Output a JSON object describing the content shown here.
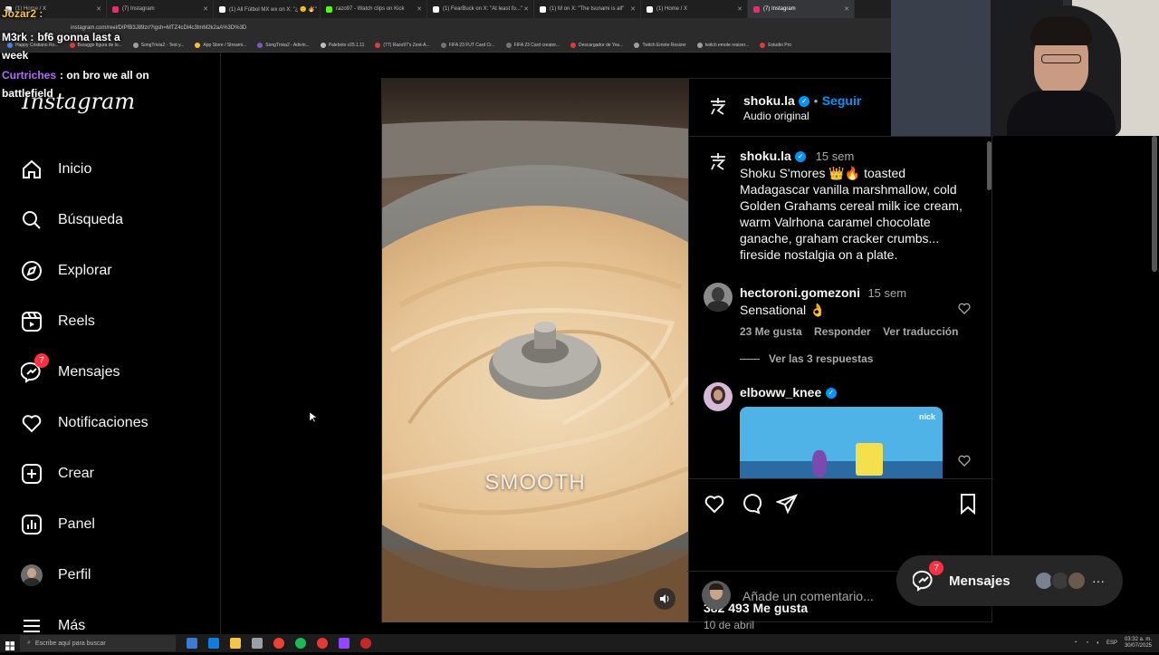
{
  "browser": {
    "tabs": [
      {
        "label": "(1) Home / X",
        "color": "#ffffff",
        "active": false
      },
      {
        "label": "(7) Instagram",
        "color": "#e1306c",
        "active": false
      },
      {
        "label": "(1) All Fútbol MX wx on X: \"¿ 🙂 🔥\"",
        "color": "#ffffff",
        "active": false
      },
      {
        "label": "razo97 - Watch clips on Kick",
        "color": "#53fc18",
        "active": false
      },
      {
        "label": "(1) FearBuck on X: \"At least fo...\"",
        "color": "#ffffff",
        "active": false
      },
      {
        "label": "(1) M on X: \"The tsunami is all\"",
        "color": "#ffffff",
        "active": false
      },
      {
        "label": "(1) Home / X",
        "color": "#ffffff",
        "active": false
      },
      {
        "label": "(7) Instagram",
        "color": "#e1306c",
        "active": true
      }
    ],
    "url": "instagram.com/reel/DIPfB3J89zr/?igsh=MTZ4cDl4c3lmM2k2aA%3D%3D",
    "bookmarks": [
      {
        "label": "Happy Cristiano Ro...",
        "color": "#4285f4"
      },
      {
        "label": "Buraggo figura de lo...",
        "color": "#e53935"
      },
      {
        "label": "SongTrivia2 - Test y...",
        "color": "#9e9e9e"
      },
      {
        "label": "App Store / Streami...",
        "color": "#fbc02d"
      },
      {
        "label": "SongTrivia2 - Adivin...",
        "color": "#7e57c2"
      },
      {
        "label": "Palebots v25.1.11",
        "color": "#bdbdbd"
      },
      {
        "label": "(77) Razo97's Zest-A...",
        "color": "#e53935"
      },
      {
        "label": "FIFA 23 FUT Card Cr...",
        "color": "#757575"
      },
      {
        "label": "FIFA 23 Card creator...",
        "color": "#757575"
      },
      {
        "label": "Descargador de You...",
        "color": "#e53935"
      },
      {
        "label": "Twitch Emote Resizer",
        "color": "#9e9e9e"
      },
      {
        "label": "twitch emote resizer...",
        "color": "#9e9e9e"
      },
      {
        "label": "Estudio Pro",
        "color": "#e53935"
      }
    ]
  },
  "chat": [
    {
      "user": "Jozar2 :",
      "text": "",
      "user_color": "#f5c542"
    },
    {
      "user": "M3rk :",
      "text": "bf6 gonna last a",
      "user_color": "#ffffff"
    },
    {
      "user": "",
      "text": "week",
      "user_color": "#ffffff"
    },
    {
      "user": "Curtriches",
      "text": ": on bro we all on",
      "user_color": "#b36bff"
    },
    {
      "user": "",
      "text": "battlefield",
      "user_color": "#ffffff"
    }
  ],
  "sidebar": {
    "logo": "Instagram",
    "items": [
      {
        "label": "Inicio",
        "icon": "home-icon"
      },
      {
        "label": "Búsqueda",
        "icon": "search-icon"
      },
      {
        "label": "Explorar",
        "icon": "compass-icon"
      },
      {
        "label": "Reels",
        "icon": "reels-icon"
      },
      {
        "label": "Mensajes",
        "icon": "messenger-icon",
        "badge": "7"
      },
      {
        "label": "Notificaciones",
        "icon": "heart-icon"
      },
      {
        "label": "Crear",
        "icon": "plus-square-icon"
      },
      {
        "label": "Panel",
        "icon": "chart-icon"
      },
      {
        "label": "Perfil",
        "icon": "profile-avatar"
      },
      {
        "label": "Más",
        "icon": "menu-icon"
      }
    ]
  },
  "post": {
    "media_caption": "SMOOTH",
    "author": "shoku.la",
    "follow_label": "Seguir",
    "audio": "Audio original",
    "caption": {
      "user": "shoku.la",
      "time": "15 sem",
      "text": "Shoku S'mores 👑🔥 toasted Madagascar vanilla marshmallow, cold Golden Grahams cereal milk ice cream, warm Valrhona caramel chocolate ganache, graham cracker crumbs... fireside nostalgia on a plate."
    },
    "comments": [
      {
        "user": "hectoroni.gomezoni",
        "time": "15 sem",
        "text": "Sensational 👌",
        "likes": "23 Me gusta",
        "reply": "Responder",
        "translate": "Ver traducción",
        "replies": "Ver las 3 respuestas"
      },
      {
        "user": "elboww_knee",
        "time": "",
        "text": "",
        "gif_label": "nick"
      }
    ],
    "likes": "382 493 Me gusta",
    "date": "10 de abril",
    "comment_placeholder": "Añade un comentario..."
  },
  "messages_pill": {
    "label": "Mensajes",
    "badge": "7"
  },
  "taskbar": {
    "search_placeholder": "Escribe aquí para buscar",
    "lang": "ESP",
    "time": "03:32 a. m.",
    "date": "30/07/2025"
  }
}
